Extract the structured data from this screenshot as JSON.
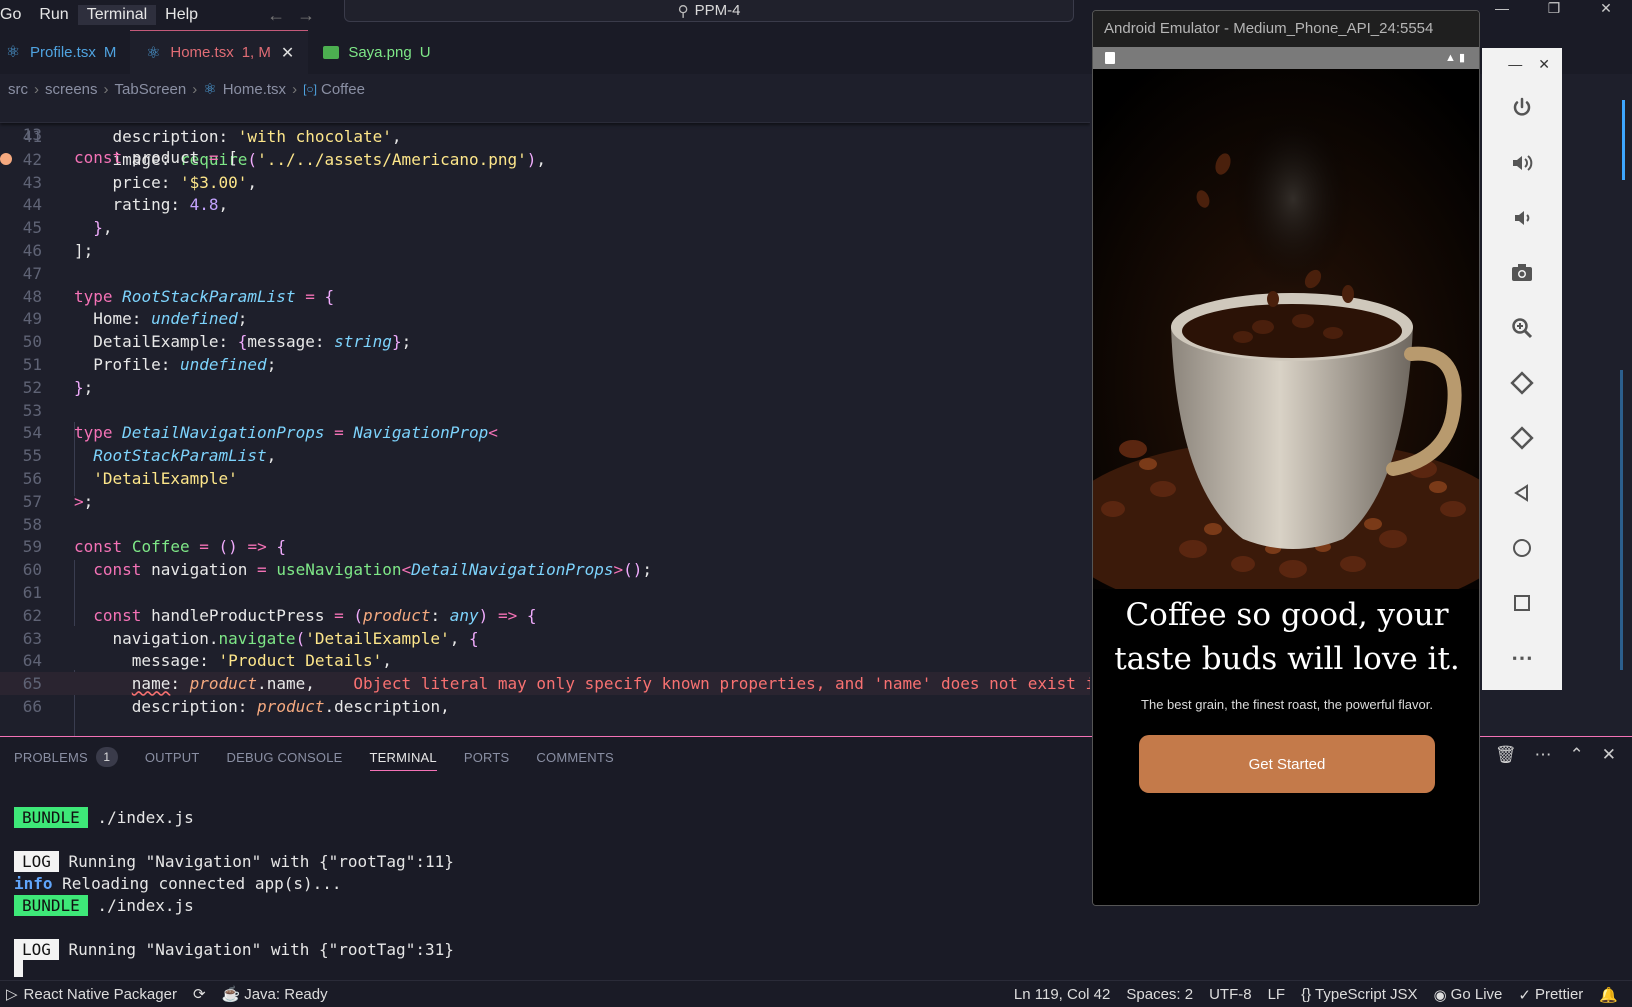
{
  "menu": [
    "Go",
    "Run",
    "Terminal",
    "Help"
  ],
  "command_center": {
    "label": "PPM-4"
  },
  "tabs": [
    {
      "name": "Profile.tsx",
      "badge": "M",
      "active": false,
      "icon": "react-icon"
    },
    {
      "name": "Home.tsx",
      "badge": "1, M",
      "active": true,
      "icon": "react-icon"
    },
    {
      "name": "Saya.png",
      "badge": "U",
      "active": false,
      "icon": "image-icon"
    }
  ],
  "breadcrumb": [
    "src",
    "screens",
    "TabScreen",
    "Home.tsx",
    "Coffee"
  ],
  "editor": {
    "sticky_line_number": "13",
    "sticky_line_text": "const product = [",
    "lines": [
      {
        "n": "41",
        "t": "    description: 'with chocolate',"
      },
      {
        "n": "42",
        "t": "    image: require('../../assets/Americano.png'),"
      },
      {
        "n": "43",
        "t": "    price: '$3.00',"
      },
      {
        "n": "44",
        "t": "    rating: 4.8,"
      },
      {
        "n": "45",
        "t": "  },"
      },
      {
        "n": "46",
        "t": "];"
      },
      {
        "n": "47",
        "t": ""
      },
      {
        "n": "48",
        "t": "type RootStackParamList = {"
      },
      {
        "n": "49",
        "t": "  Home: undefined;"
      },
      {
        "n": "50",
        "t": "  DetailExample: {message: string};"
      },
      {
        "n": "51",
        "t": "  Profile: undefined;"
      },
      {
        "n": "52",
        "t": "};"
      },
      {
        "n": "53",
        "t": ""
      },
      {
        "n": "54",
        "t": "type DetailNavigationProps = NavigationProp<"
      },
      {
        "n": "55",
        "t": "  RootStackParamList,"
      },
      {
        "n": "56",
        "t": "  'DetailExample'"
      },
      {
        "n": "57",
        "t": ">;"
      },
      {
        "n": "58",
        "t": ""
      },
      {
        "n": "59",
        "t": "const Coffee = () => {"
      },
      {
        "n": "60",
        "t": "  const navigation = useNavigation<DetailNavigationProps>();"
      },
      {
        "n": "61",
        "t": ""
      },
      {
        "n": "62",
        "t": "  const handleProductPress = (product: any) => {"
      },
      {
        "n": "63",
        "t": "    navigation.navigate('DetailExample', {"
      },
      {
        "n": "64",
        "t": "      message: 'Product Details',"
      },
      {
        "n": "65",
        "t": "      name: product.name,    Object literal may only specify known properties, and 'name' does not exist i"
      },
      {
        "n": "66",
        "t": "      description: product.description,"
      }
    ],
    "error_message": "Object literal may only specify known properties, and 'name' does not exist i"
  },
  "panel": {
    "tabs": [
      "PROBLEMS",
      "OUTPUT",
      "DEBUG CONSOLE",
      "TERMINAL",
      "PORTS",
      "COMMENTS"
    ],
    "active_tab": "TERMINAL",
    "problems_count": "1",
    "terminal": [
      {
        "tag": "BUNDLE",
        "text": " ./index.js"
      },
      {
        "tag": "LOG",
        "text": " Running \"Navigation\" with {\"rootTag\":11}"
      },
      {
        "tag": "info",
        "text": " Reloading connected app(s)..."
      },
      {
        "tag": "BUNDLE",
        "text": " ./index.js"
      },
      {
        "tag": "LOG",
        "text": " Running \"Navigation\" with {\"rootTag\":31}"
      }
    ]
  },
  "statusbar": {
    "left": [
      "React Native Packager",
      "Java: Ready"
    ],
    "right": [
      "Ln 119, Col 42",
      "Spaces: 2",
      "UTF-8",
      "LF",
      "{} TypeScript JSX",
      "Go Live",
      "Prettier"
    ]
  },
  "emulator": {
    "title": "Android Emulator - Medium_Phone_API_24:5554",
    "headline_line1": "Coffee so good, your",
    "headline_line2": "taste buds will love it.",
    "subline": "The best grain, the finest roast, the powerful flavor.",
    "cta": "Get Started",
    "side_controls": [
      "power-icon",
      "volume-up-icon",
      "volume-down-icon",
      "camera-icon",
      "zoom-icon",
      "rotate-left-icon",
      "rotate-right-icon",
      "back-icon",
      "home-icon",
      "overview-icon",
      "more-icon"
    ]
  },
  "colors": {
    "accent": "#f472b6",
    "cta": "#c47a4a",
    "bundle_tag": "#3ee878"
  }
}
